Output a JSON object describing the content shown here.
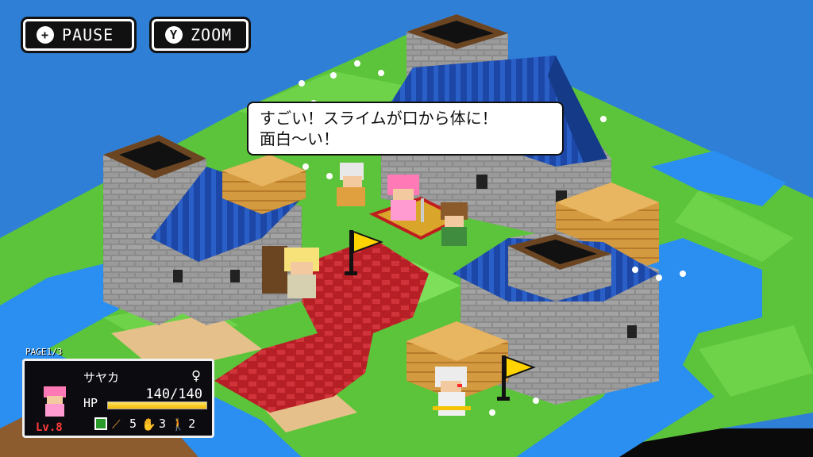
{
  "hud": {
    "pause_label": "PAUSE",
    "pause_icon": "plus-icon",
    "zoom_label": "ZOOM",
    "zoom_icon": "y-button-icon",
    "zoom_icon_glyph": "Y"
  },
  "dialogue": {
    "line1": "すごい！スライムが口から体に！",
    "line2": "面白〜い！"
  },
  "status_panel": {
    "page": "PAGE1/3",
    "character_name": "サヤカ",
    "gender_symbol": "♀",
    "hp_label": "HP",
    "hp_current": 140,
    "hp_max": 140,
    "hp_text": "140/140",
    "hp_fraction": 1.0,
    "level": "Lv.8",
    "stats": [
      {
        "icon": "staff-icon",
        "value": "5"
      },
      {
        "icon": "hand-icon",
        "value": "3"
      },
      {
        "icon": "walk-icon",
        "value": "2"
      }
    ]
  },
  "colors": {
    "sky": "#2f7fd6",
    "grass": "#5cc43a",
    "water": "#2a8ff0",
    "roof": "#1f4fb0",
    "stone": "#8a8a8a",
    "crate": "#d9a24a",
    "path": "#c2262b",
    "flag": "#ffd400",
    "hp_bar": "#f5b800",
    "level_text": "#ff3b3b"
  }
}
